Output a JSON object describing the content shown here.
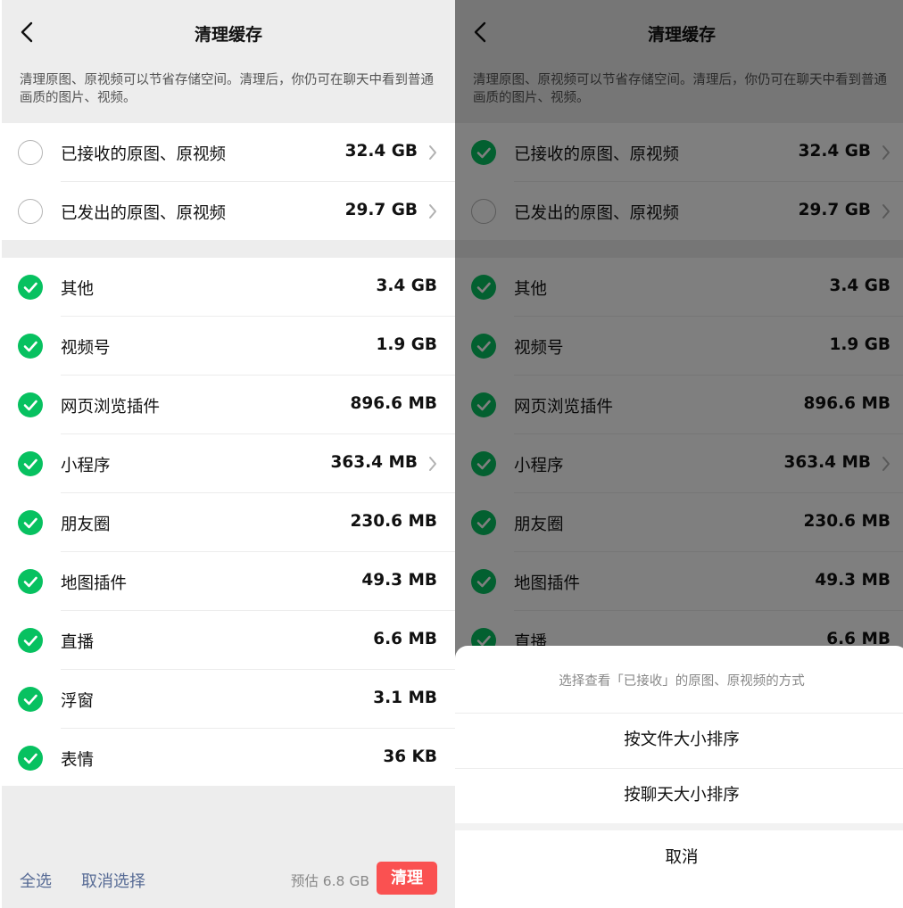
{
  "colors": {
    "accent_green": "#07c160",
    "danger_red": "#fa5151",
    "link_blue": "#576b95"
  },
  "icons": {
    "back": "chevron-left-icon",
    "arrow": "chevron-right-icon",
    "checked": "check-circle-icon",
    "unchecked": "empty-circle-icon"
  },
  "page": {
    "title": "清理缓存",
    "description": "清理原图、原视频可以节省存储空间。清理后，你仍可在聊天中看到普通画质的图片、视频。"
  },
  "original_media": [
    {
      "label": "已接收的原图、原视频",
      "size": "32.4 GB"
    },
    {
      "label": "已发出的原图、原视频",
      "size": "29.7 GB"
    }
  ],
  "cache_items": [
    {
      "label": "其他",
      "size": "3.4 GB"
    },
    {
      "label": "视频号",
      "size": "1.9 GB"
    },
    {
      "label": "网页浏览插件",
      "size": "896.6 MB"
    },
    {
      "label": "小程序",
      "size": "363.4 MB"
    },
    {
      "label": "朋友圈",
      "size": "230.6 MB"
    },
    {
      "label": "地图插件",
      "size": "49.3 MB"
    },
    {
      "label": "直播",
      "size": "6.6 MB"
    },
    {
      "label": "浮窗",
      "size": "3.1 MB"
    },
    {
      "label": "表情",
      "size": "36 KB"
    }
  ],
  "bottom_bar": {
    "select_all": "全选",
    "deselect": "取消选择",
    "estimate": "预估 6.8 GB",
    "clean": "清理"
  },
  "action_sheet": {
    "title": "选择查看「已接收」的原图、原视频的方式",
    "options": [
      "按文件大小排序",
      "按聊天大小排序"
    ],
    "cancel": "取消"
  }
}
